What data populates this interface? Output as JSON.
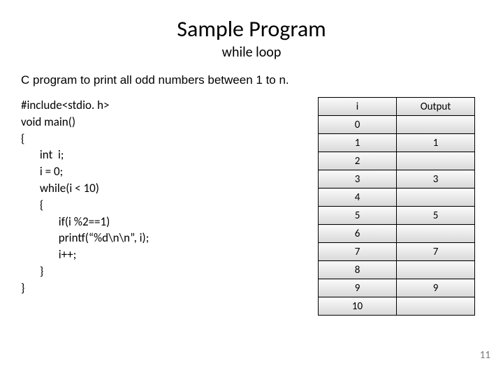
{
  "title": "Sample Program",
  "subtitle": "while loop",
  "description": "C program to print all odd numbers between 1 to n.",
  "code": "#include<stdio. h>\nvoid main()\n{\n       int  i;\n       i = 0;\n       while(i < 10)\n       {\n              if(i %2==1)\n              printf(“%d\\n\\n”, i);\n              i++;\n       }\n}",
  "table": {
    "headers": {
      "i": "i",
      "output": "Output"
    },
    "rows": [
      {
        "i": "0",
        "output": ""
      },
      {
        "i": "1",
        "output": "1"
      },
      {
        "i": "2",
        "output": ""
      },
      {
        "i": "3",
        "output": "3"
      },
      {
        "i": "4",
        "output": ""
      },
      {
        "i": "5",
        "output": "5"
      },
      {
        "i": "6",
        "output": ""
      },
      {
        "i": "7",
        "output": "7"
      },
      {
        "i": "8",
        "output": ""
      },
      {
        "i": "9",
        "output": "9"
      },
      {
        "i": "10",
        "output": ""
      }
    ]
  },
  "page_number": "11"
}
